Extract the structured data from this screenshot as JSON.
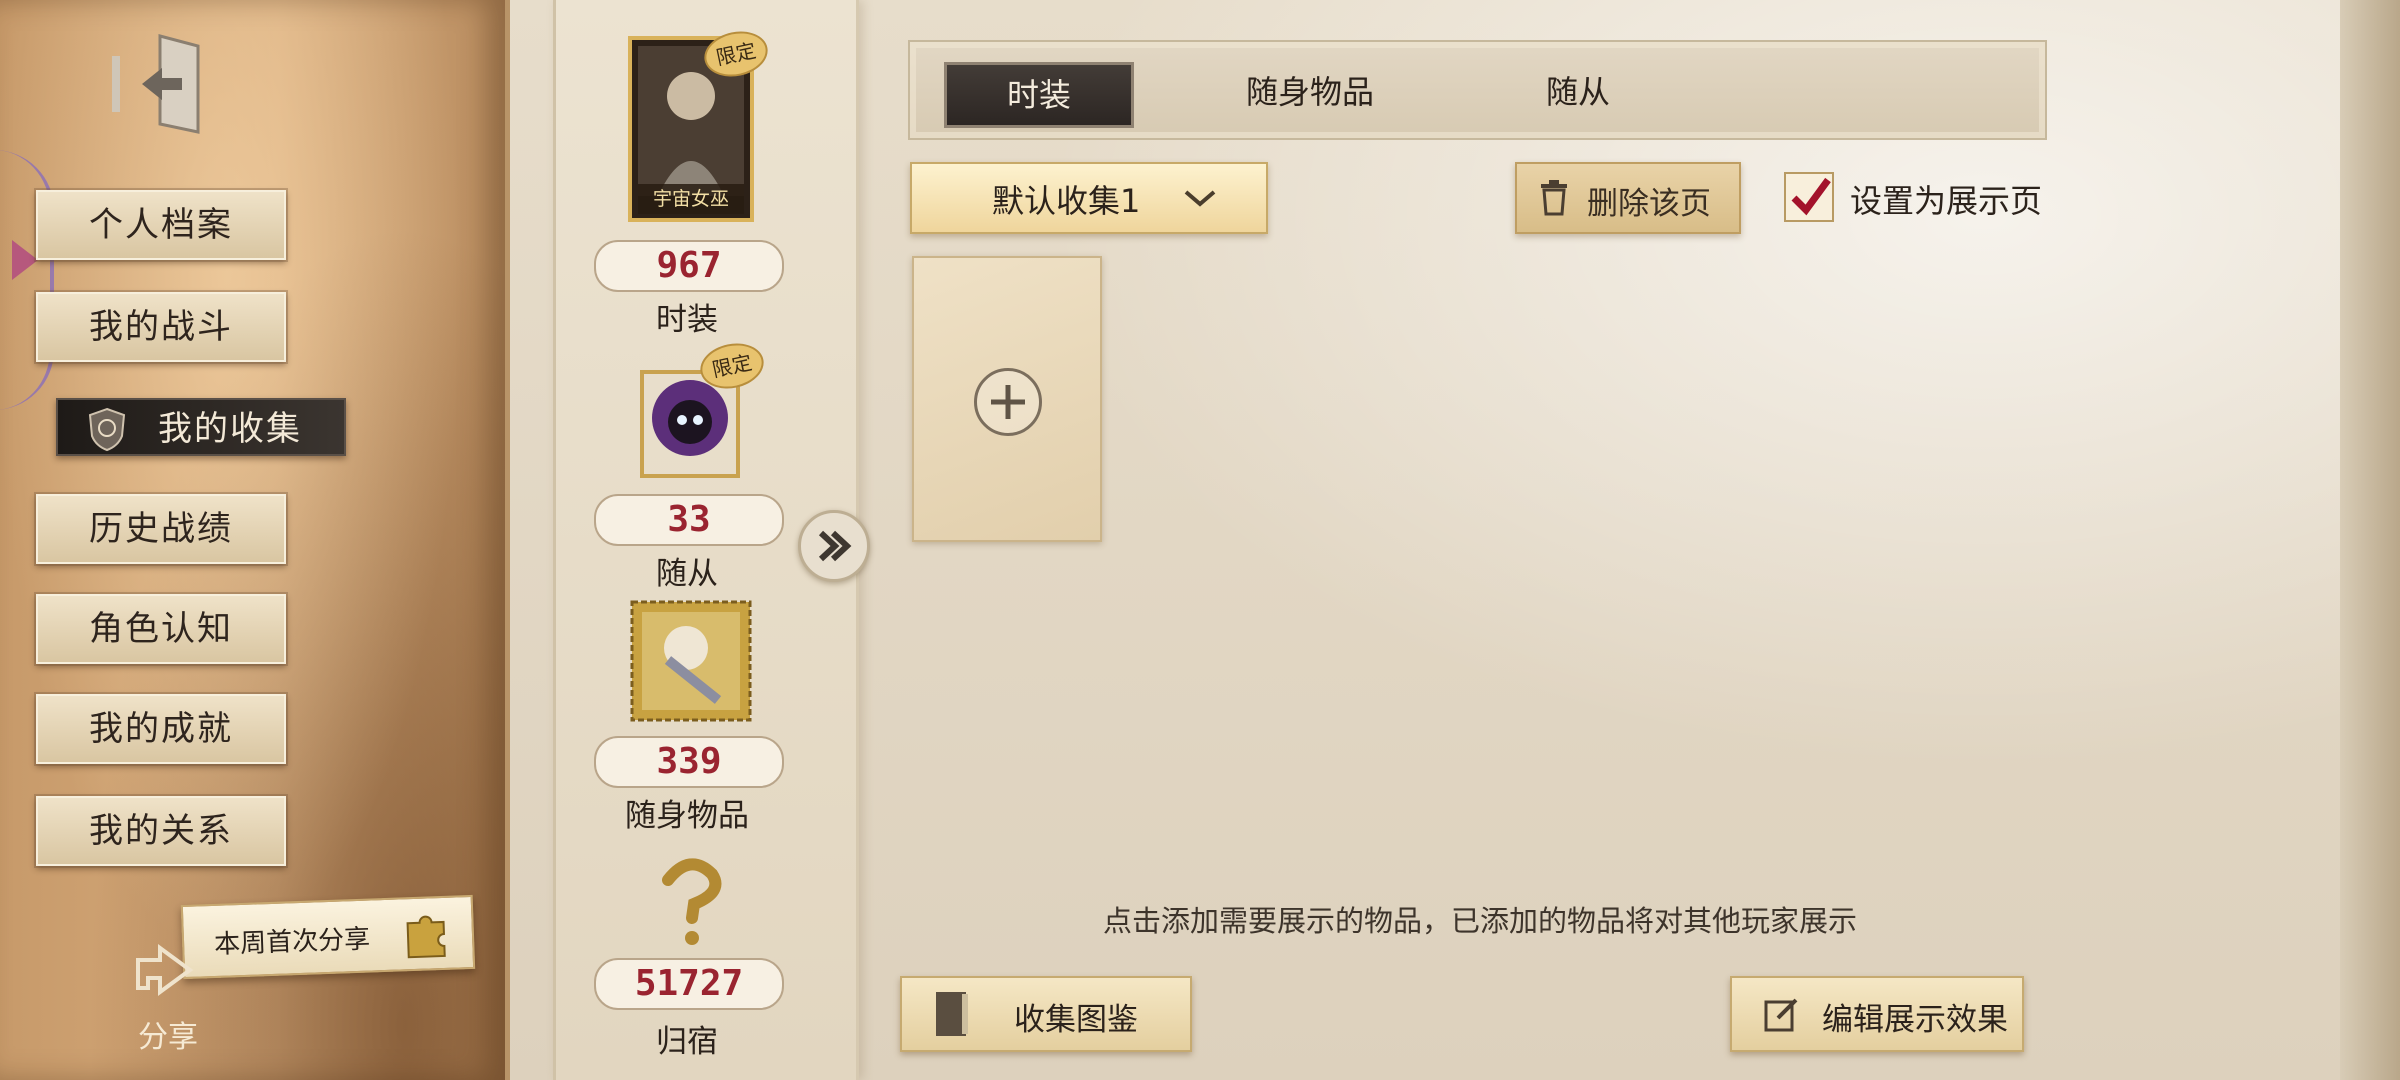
{
  "sidebar": {
    "items": [
      {
        "label": "个人档案"
      },
      {
        "label": "我的战斗"
      },
      {
        "label": "我的收集"
      },
      {
        "label": "历史战绩"
      },
      {
        "label": "角色认知"
      },
      {
        "label": "我的成就"
      },
      {
        "label": "我的关系"
      }
    ],
    "active_index": 2,
    "share_banner": "本周首次分享",
    "share_label": "分享"
  },
  "collection_stats": {
    "fashion": {
      "badge": "限定",
      "card_name": "宇宙女巫",
      "count": "967",
      "label": "时装"
    },
    "follower": {
      "badge": "限定",
      "count": "33",
      "label": "随从"
    },
    "accessory": {
      "count": "339",
      "label": "随身物品"
    },
    "home": {
      "count": "51727",
      "label": "归宿"
    }
  },
  "tabs": [
    {
      "label": "时装",
      "active": true
    },
    {
      "label": "随身物品",
      "active": false
    },
    {
      "label": "随从",
      "active": false
    }
  ],
  "dropdown": {
    "selected": "默认收集1"
  },
  "delete_button": "删除该页",
  "display_checkbox": {
    "label": "设置为展示页",
    "checked": true
  },
  "hint": "点击添加需要展示的物品，已添加的物品将对其他玩家展示",
  "bottom": {
    "catalog_button": "收集图鉴",
    "edit_button": "编辑展示效果"
  },
  "colors": {
    "count_red": "#9a2430",
    "check_red": "#a3122b",
    "gold": "#e8c36e"
  }
}
